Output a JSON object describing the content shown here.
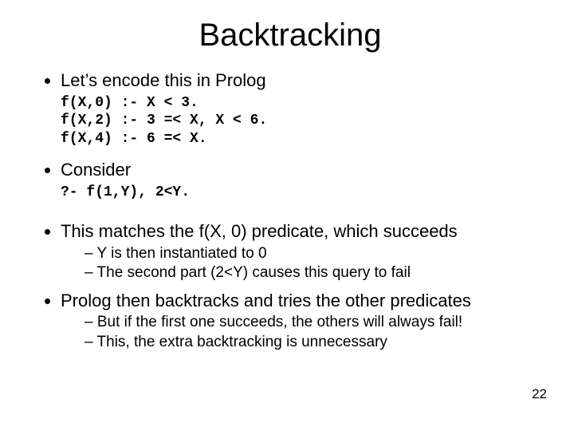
{
  "title": "Backtracking",
  "b1": {
    "text": "Let’s encode this in Prolog"
  },
  "code1": {
    "l1": "f(X,0) :- X < 3.",
    "l2": "f(X,2) :- 3 =< X, X < 6.",
    "l3": "f(X,4) :- 6 =< X."
  },
  "b2": {
    "text": "Consider"
  },
  "code2": {
    "l1": "?- f(1,Y), 2<Y."
  },
  "b3": {
    "text": "This matches the f(X, 0) predicate, which succeeds",
    "sub1": "Y is then instantiated to 0",
    "sub2": "The second part (2<Y) causes this query to fail"
  },
  "b4": {
    "text": "Prolog then backtracks and tries the other predicates",
    "sub1": "But if the first one succeeds, the others will always fail!",
    "sub2": "This, the extra backtracking is unnecessary"
  },
  "page": "22"
}
